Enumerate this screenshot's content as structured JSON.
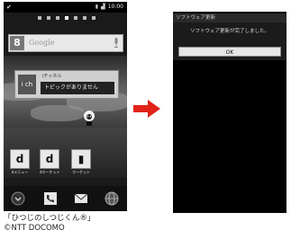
{
  "left_screen": {
    "status_time": "10:00",
    "search_placeholder": "Google",
    "widget_header": "iチャネル",
    "widget_message": "トピックがありません",
    "apps": [
      {
        "tile": "d",
        "label": "dメニュー"
      },
      {
        "tile": "d",
        "label": "dマーケット"
      },
      {
        "tile": "▮",
        "label": "マーケット"
      }
    ]
  },
  "caption": {
    "line1": "「ひつじのしつじくん®」",
    "line2": "©NTT DOCOMO"
  },
  "right_screen": {
    "dialog_title": "ソフトウェア更新",
    "dialog_message": "ソフトウェア更新が完了しました。",
    "ok_button": "OK"
  },
  "colors": {
    "arrow": "#e2231a"
  }
}
